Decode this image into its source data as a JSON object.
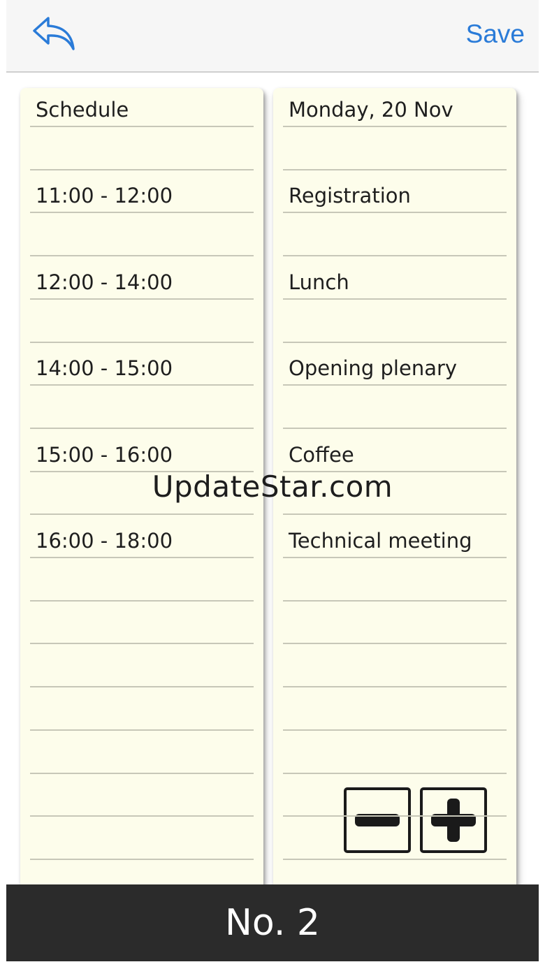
{
  "navbar": {
    "back_icon": "reply-arrow-icon",
    "save_label": "Save",
    "accent_color": "#2a7bd8"
  },
  "schedule": {
    "left_rows": [
      "Schedule",
      "",
      "11:00 - 12:00",
      "",
      "12:00 - 14:00",
      "",
      "14:00 - 15:00",
      "",
      "15:00 - 16:00",
      "",
      "16:00 - 18:00",
      "",
      "",
      "",
      "",
      "",
      "",
      ""
    ],
    "right_rows": [
      "Monday, 20 Nov",
      "",
      "Registration",
      "",
      "Lunch",
      "",
      "Opening plenary",
      "",
      "Coffee",
      "",
      "Technical meeting",
      "",
      "",
      "",
      "",
      "",
      "",
      ""
    ]
  },
  "controls": {
    "minus_icon": "minus-icon",
    "plus_icon": "plus-icon"
  },
  "footer": {
    "label": "No. 2"
  },
  "watermark": "UpdateStar.com"
}
